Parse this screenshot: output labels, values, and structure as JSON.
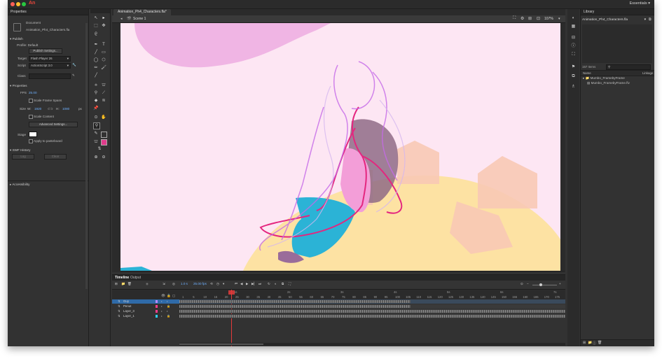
{
  "app": {
    "logo": "An",
    "workspace": "Essentials"
  },
  "properties": {
    "header": "Properties",
    "doc_type": "Document",
    "doc_name": "Animation_Ph4_Characters.fla",
    "publish": {
      "section": "Publish",
      "profile_label": "Profile:",
      "profile_value": "Default",
      "settings_button": "Publish Settings...",
      "target_label": "Target",
      "target_value": "Flash Player 26",
      "script_label": "Script",
      "script_value": "ActionScript 3.0",
      "class_label": "Class"
    },
    "properties_section": {
      "section": "Properties",
      "fps_label": "FPS",
      "fps_value": "25.00",
      "scale_frame_spans": "Scale Frame Spans",
      "size_label": "Size",
      "w_label": "W:",
      "w_value": "1920",
      "h_label": "H:",
      "h_value": "1080",
      "unit": "px",
      "scale_content": "Scale Content",
      "advanced_settings": "Advanced Settings...",
      "stage_label": "Stage",
      "apply_pasteboard": "Apply to pasteboard"
    },
    "swf_history": {
      "section": "SWF History",
      "log_button": "Log",
      "clear_button": "Clear"
    },
    "accessibility": {
      "section": "Accessibility"
    }
  },
  "document": {
    "tab": "Animation_Ph4_Characters.fla*",
    "scene": "Scene 1",
    "zoom": "107%"
  },
  "timeline": {
    "tabs": [
      "Timeline",
      "Output"
    ],
    "fps": "25.00 fps",
    "current_frame": "1.0 s",
    "ruler_numbers": [
      "1",
      "5",
      "10",
      "15",
      "20",
      "25",
      "30",
      "35",
      "40",
      "45",
      "50",
      "55",
      "60",
      "65",
      "70",
      "75",
      "80",
      "85",
      "90",
      "95",
      "100",
      "105",
      "110",
      "115",
      "120",
      "125",
      "130",
      "135",
      "140",
      "145",
      "150",
      "155",
      "160",
      "165",
      "170",
      "175"
    ],
    "ruler_seconds": [
      "1s",
      "2s",
      "3s",
      "4s",
      "5s",
      "6s",
      "7s"
    ],
    "layers": [
      {
        "name": "Guy",
        "color": "#b58bff",
        "selected": true
      },
      {
        "name": "Penut",
        "color": "#ff3d8c",
        "selected": false
      },
      {
        "name": "Layer_3",
        "color": "#ff3d8c",
        "selected": false
      },
      {
        "name": "Layer_1",
        "color": "#2ed3ff",
        "selected": false
      }
    ]
  },
  "library": {
    "header": "Library",
    "document": "Animation_Ph4_Characters.fla",
    "item_count": "157 Items",
    "col_name": "Name",
    "col_linkage": "Linkage",
    "items": [
      "Mumbo_FramebyFrame",
      "Mumbo_FramebyFrame.flv"
    ]
  },
  "colors": {
    "stage_bg": "#fde6f3",
    "accent": "#e03c8c",
    "layer_selected": "#2f6aa8"
  }
}
